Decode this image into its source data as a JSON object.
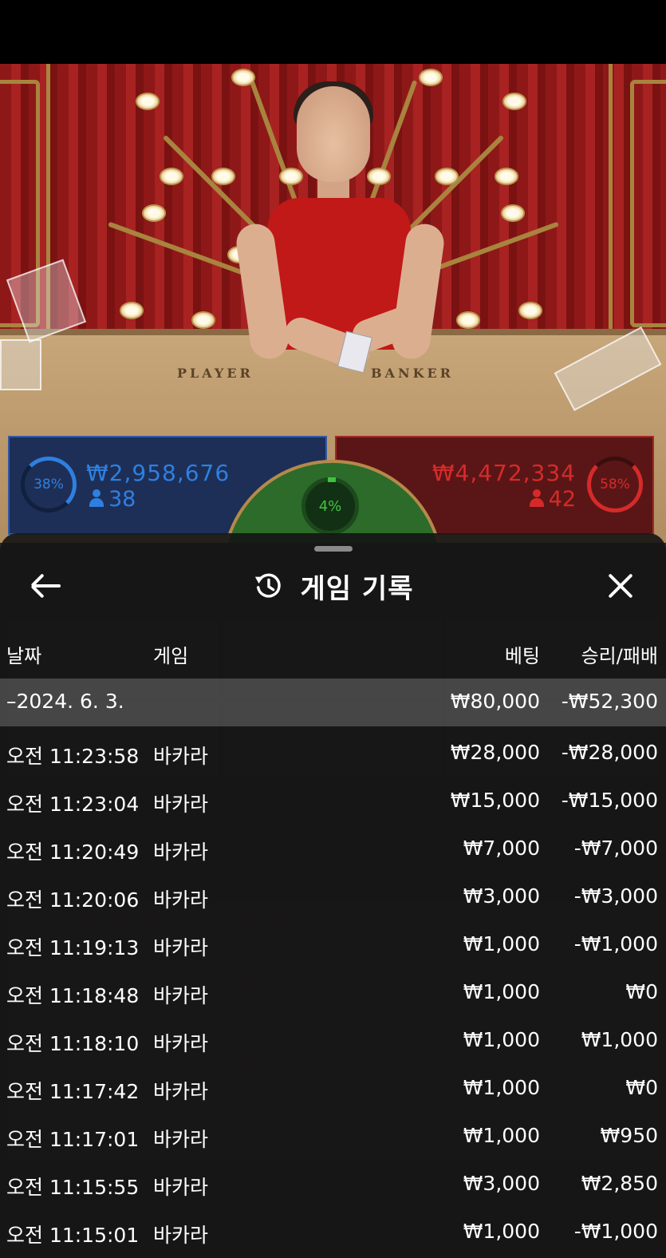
{
  "stats": {
    "player": {
      "percent": "38%",
      "amount": "₩2,958,676",
      "count": "38",
      "color": "#2f7fe0"
    },
    "tie": {
      "percent": "4%",
      "color": "#43c343"
    },
    "banker": {
      "percent": "58%",
      "amount": "₩4,472,334",
      "count": "42",
      "color": "#d62a2a"
    }
  },
  "table": {
    "player_word": "PLAYER",
    "banker_word": "BANKER"
  },
  "sheet": {
    "title": "게임 기록",
    "columns": {
      "date": "날짜",
      "game": "게임",
      "bet": "베팅",
      "result": "승리/패배"
    },
    "summary": {
      "date": "–2024. 6. 3.",
      "bet": "₩80,000",
      "result": "-₩52,300"
    },
    "rows": [
      {
        "time": "오전 11:23:58",
        "game": "바카라",
        "bet": "₩28,000",
        "result": "-₩28,000"
      },
      {
        "time": "오전 11:23:04",
        "game": "바카라",
        "bet": "₩15,000",
        "result": "-₩15,000"
      },
      {
        "time": "오전 11:20:49",
        "game": "바카라",
        "bet": "₩7,000",
        "result": "-₩7,000"
      },
      {
        "time": "오전 11:20:06",
        "game": "바카라",
        "bet": "₩3,000",
        "result": "-₩3,000"
      },
      {
        "time": "오전 11:19:13",
        "game": "바카라",
        "bet": "₩1,000",
        "result": "-₩1,000"
      },
      {
        "time": "오전 11:18:48",
        "game": "바카라",
        "bet": "₩1,000",
        "result": "₩0"
      },
      {
        "time": "오전 11:18:10",
        "game": "바카라",
        "bet": "₩1,000",
        "result": "₩1,000"
      },
      {
        "time": "오전 11:17:42",
        "game": "바카라",
        "bet": "₩1,000",
        "result": "₩0"
      },
      {
        "time": "오전 11:17:01",
        "game": "바카라",
        "bet": "₩1,000",
        "result": "₩950"
      },
      {
        "time": "오전 11:15:55",
        "game": "바카라",
        "bet": "₩3,000",
        "result": "₩2,850"
      },
      {
        "time": "오전 11:15:01",
        "game": "바카라",
        "bet": "₩1,000",
        "result": "-₩1,000"
      }
    ]
  },
  "icons": {
    "back": "arrow-left-icon",
    "history": "history-clock-icon",
    "close": "close-icon",
    "person": "person-icon"
  }
}
